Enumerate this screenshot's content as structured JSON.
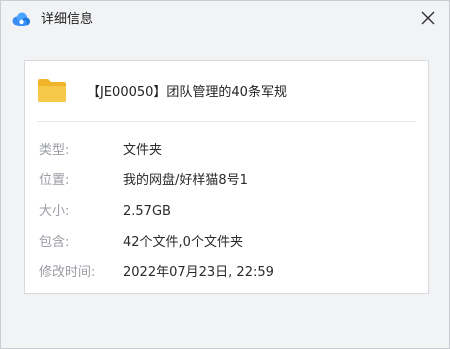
{
  "window": {
    "title": "详细信息",
    "icons": {
      "app": "baidu-netdisk-cloud-icon",
      "close": "close-icon",
      "file": "folder-icon"
    },
    "colors": {
      "background": "#f2f3f5",
      "card": "#ffffff",
      "folder": "#f5c33b",
      "cloud_blue": "#3a8ef6"
    }
  },
  "file": {
    "name": "【JE00050】团队管理的40条军规"
  },
  "details": [
    {
      "label": "类型:",
      "value": "文件夹"
    },
    {
      "label": "位置:",
      "value": "我的网盘/好样猫8号1"
    },
    {
      "label": "大小:",
      "value": "2.57GB"
    },
    {
      "label": "包含:",
      "value": "42个文件,0个文件夹"
    },
    {
      "label": "修改时间:",
      "value": "2022年07月23日, 22:59"
    }
  ]
}
